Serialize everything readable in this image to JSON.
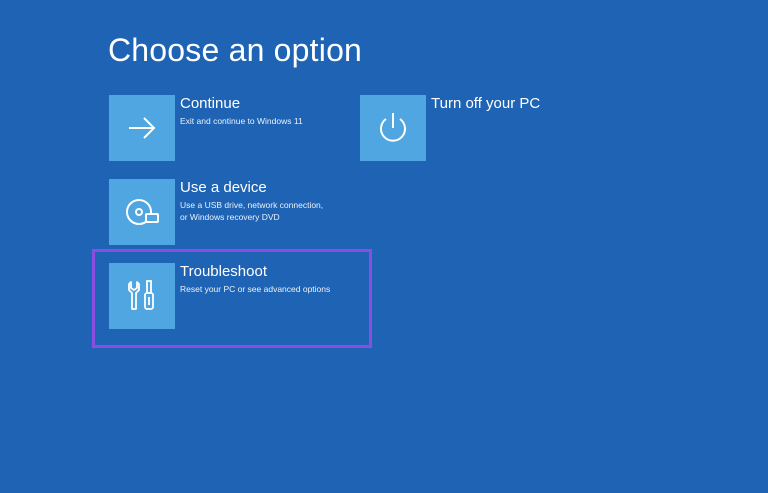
{
  "page": {
    "title": "Choose an option",
    "background_color": "#1e63b4",
    "tile_color": "#4fa6e0",
    "highlight_color": "#8a4fe0"
  },
  "options": [
    {
      "id": "continue",
      "title": "Continue",
      "description": "Exit and continue to Windows 11",
      "icon": "arrow-right-icon"
    },
    {
      "id": "use-device",
      "title": "Use a device",
      "description": "Use a USB drive, network connection,\nor Windows recovery DVD",
      "icon": "device-disc-icon"
    },
    {
      "id": "troubleshoot",
      "title": "Troubleshoot",
      "description": "Reset your PC or see advanced options",
      "icon": "tools-icon",
      "highlighted": true
    },
    {
      "id": "turn-off",
      "title": "Turn off your PC",
      "description": "",
      "icon": "power-icon"
    }
  ]
}
